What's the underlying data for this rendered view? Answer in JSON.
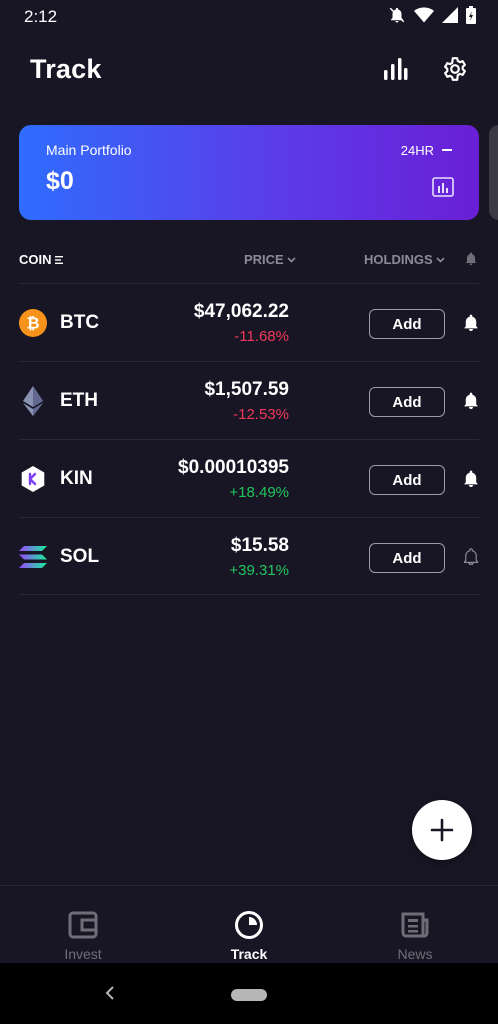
{
  "status_bar": {
    "time": "2:12"
  },
  "header": {
    "title": "Track"
  },
  "portfolio": {
    "name": "Main Portfolio",
    "period": "24HR",
    "value": "$0"
  },
  "columns": {
    "coin": "COIN",
    "price": "PRICE",
    "holdings": "HOLDINGS"
  },
  "coins": [
    {
      "symbol": "BTC",
      "price": "$47,062.22",
      "change": "-11.68%",
      "trend": "neg",
      "add_label": "Add",
      "alert_on": true,
      "logo_color": "#f7931a"
    },
    {
      "symbol": "ETH",
      "price": "$1,507.59",
      "change": "-12.53%",
      "trend": "neg",
      "add_label": "Add",
      "alert_on": true,
      "logo_color": "#8a92b2"
    },
    {
      "symbol": "KIN",
      "price": "$0.00010395",
      "change": "+18.49%",
      "trend": "pos",
      "add_label": "Add",
      "alert_on": true,
      "logo_color": "#ffffff"
    },
    {
      "symbol": "SOL",
      "price": "$15.58",
      "change": "+39.31%",
      "trend": "pos",
      "add_label": "Add",
      "alert_on": false,
      "logo_color": "#9945ff"
    }
  ],
  "bottom_nav": [
    {
      "label": "Invest",
      "icon": "wallet-icon",
      "active": false
    },
    {
      "label": "Track",
      "icon": "pie-chart-icon",
      "active": true
    },
    {
      "label": "News",
      "icon": "newspaper-icon",
      "active": false
    }
  ],
  "colors": {
    "background": "#181624",
    "negative": "#f0385a",
    "positive": "#22c55e",
    "card_start": "#2f6cff",
    "card_end": "#6a1fd6"
  }
}
